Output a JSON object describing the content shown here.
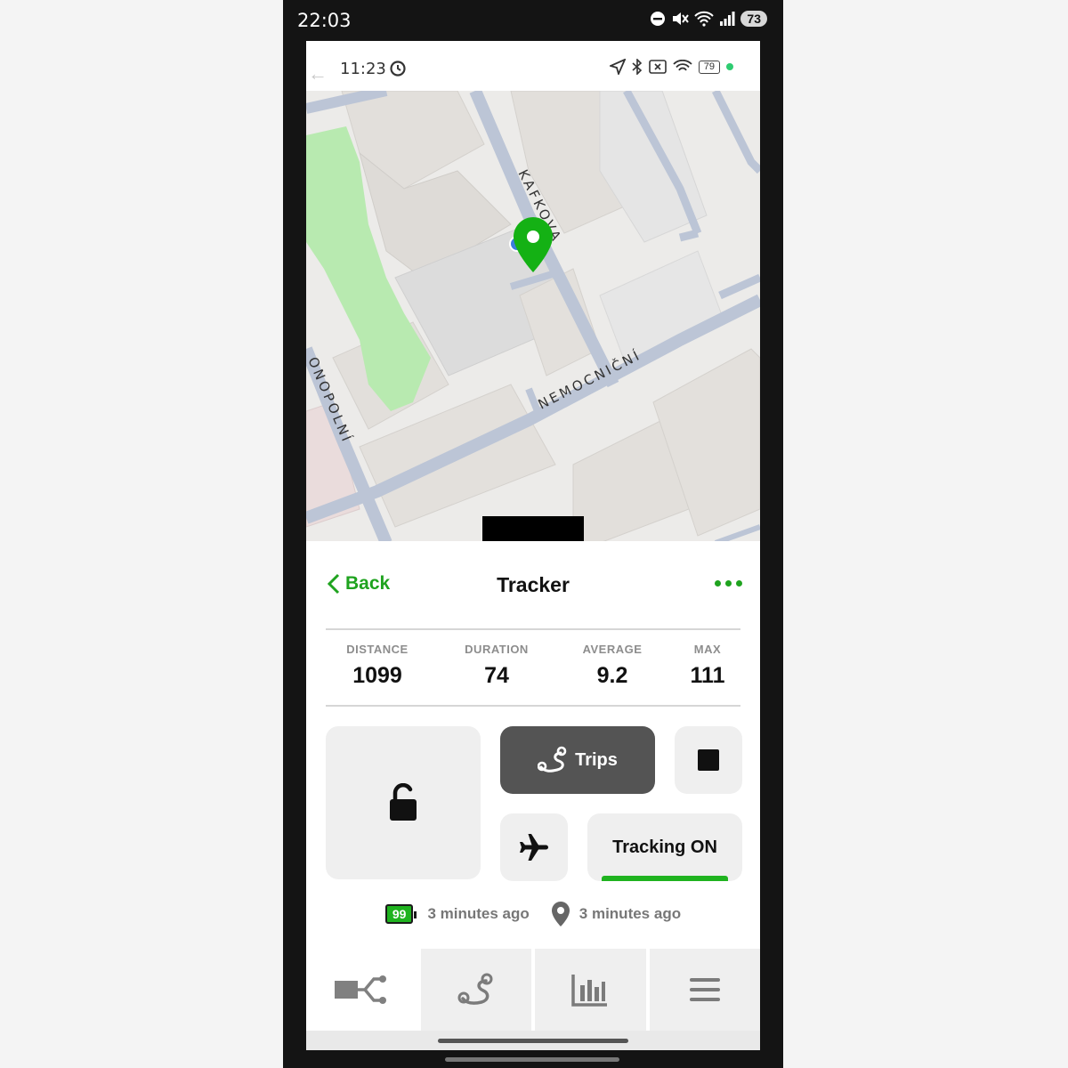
{
  "device_status": {
    "time": "22:03",
    "battery": "73"
  },
  "app_status": {
    "time": "11:23",
    "battery": "79"
  },
  "map": {
    "street_labels": [
      "KAFKOVA",
      "NEMOCNIČNÍ",
      "ONOPOLNÍ"
    ],
    "colors": {
      "park": "#b8eab0",
      "road": "#bcc5d6",
      "marker": "#14b114"
    }
  },
  "header": {
    "back_label": "Back",
    "title": "Tracker"
  },
  "stats": [
    {
      "label": "DISTANCE",
      "value": "1099"
    },
    {
      "label": "DURATION",
      "value": "74"
    },
    {
      "label": "AVERAGE",
      "value": "9.2"
    },
    {
      "label": "MAX",
      "value": "111"
    }
  ],
  "actions": {
    "trips_label": "Trips",
    "tracking_label": "Tracking ON"
  },
  "info": {
    "battery_value": "99",
    "battery_updated": "3 minutes ago",
    "location_updated": "3 minutes ago"
  },
  "tabs": [
    {
      "icon": "device-tree-icon",
      "active": true
    },
    {
      "icon": "route-icon",
      "active": false
    },
    {
      "icon": "bar-chart-icon",
      "active": false
    },
    {
      "icon": "menu-icon",
      "active": false
    }
  ],
  "accent_color": "#1fa31f"
}
